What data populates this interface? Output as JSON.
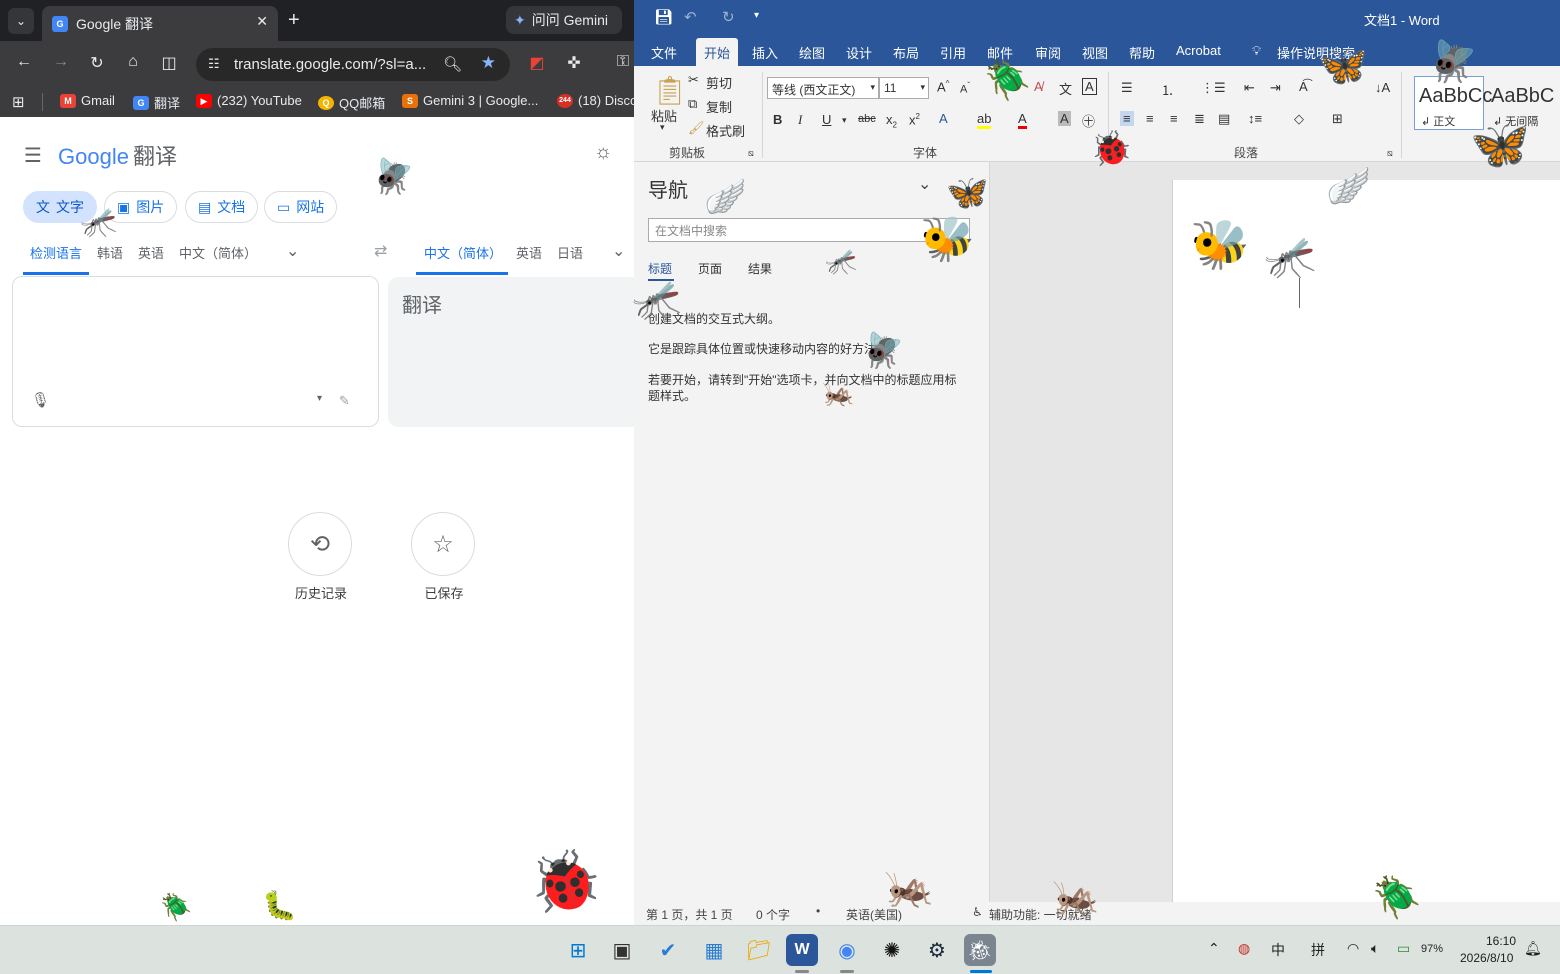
{
  "chrome": {
    "tab_title": "Google 翻译",
    "gemini_chip": "问问 Gemini",
    "url": "translate.google.com/?sl=a...",
    "bookmarks": [
      "Gmail",
      "翻译",
      "(232) YouTube",
      "QQ邮箱",
      "Gemini 3 | Google...",
      "(18) Disco"
    ],
    "bookmark_badge": "244"
  },
  "translate": {
    "logo_prefix": "Google",
    "logo_suffix": "翻译",
    "modes": [
      "文字",
      "图片",
      "文档",
      "网站"
    ],
    "source_langs": [
      "检测语言",
      "韩语",
      "英语",
      "中文（简体）"
    ],
    "target_langs": [
      "中文（简体）",
      "英语",
      "日语"
    ],
    "output_placeholder": "翻译",
    "history_label": "历史记录",
    "saved_label": "已保存"
  },
  "word": {
    "title": "文档1 - Word",
    "tabs": [
      "文件",
      "开始",
      "插入",
      "绘图",
      "设计",
      "布局",
      "引用",
      "邮件",
      "审阅",
      "视图",
      "帮助",
      "Acrobat"
    ],
    "tell_me": "操作说明搜索",
    "clipboard": {
      "paste": "粘贴",
      "cut": "剪切",
      "copy": "复制",
      "format_painter": "格式刷",
      "group": "剪贴板"
    },
    "font": {
      "name": "等线 (西文正文)",
      "size": "11",
      "group": "字体"
    },
    "paragraph_group": "段落",
    "styles": [
      {
        "preview": "AaBbCc",
        "name": "正文"
      },
      {
        "preview": "AaBbC",
        "name": "无间隔"
      }
    ],
    "nav": {
      "title": "导航",
      "search_placeholder": "在文档中搜索",
      "tabs": [
        "标题",
        "页面",
        "结果"
      ],
      "lines": [
        "创建文档的交互式大纲。",
        "它是跟踪具体位置或快速移动内容的好方法。",
        "若要开始，请转到\"开始\"选项卡，并向文档中的标题应用标题样式。"
      ]
    },
    "status": {
      "page": "第 1 页，共 1 页",
      "words": "0 个字",
      "lang": "英语(美国)",
      "accessibility": "辅助功能: 一切就绪"
    }
  },
  "taskbar": {
    "ime_lang": "中",
    "ime_mode": "拼",
    "battery": "97%",
    "time": "16:10",
    "date": "2026/8/10"
  }
}
